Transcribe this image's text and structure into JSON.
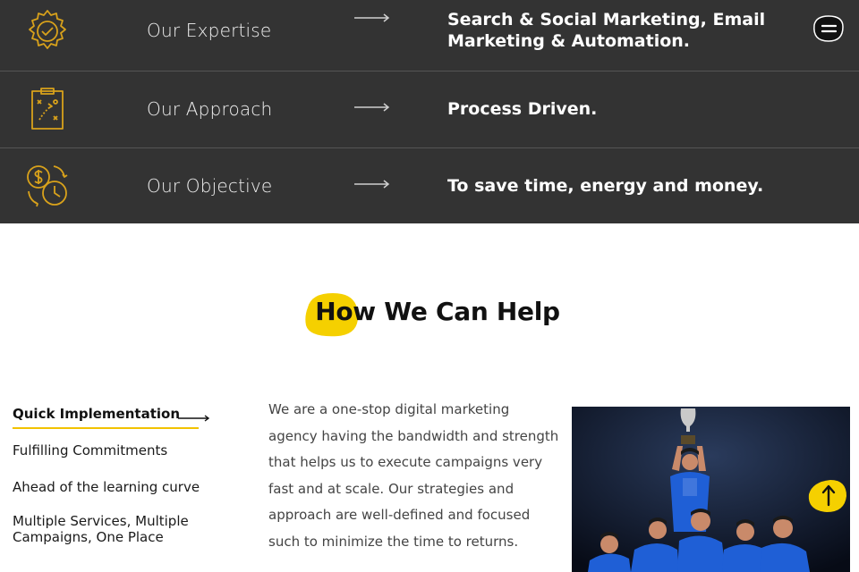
{
  "features": [
    {
      "icon": "gear-check-icon",
      "label": "Our Expertise",
      "value": "Search & Social Marketing, Email Marketing & Automation."
    },
    {
      "icon": "strategy-board-icon",
      "label": "Our Approach",
      "value": "Process Driven."
    },
    {
      "icon": "money-time-icon",
      "label": "Our Objective",
      "value": "To save time, energy and money."
    }
  ],
  "help": {
    "title": "How We Can Help",
    "tabs": [
      "Quick Implementation",
      "Fulfilling Commitments",
      "Ahead of the learning curve",
      "Multiple Services, Multiple Campaigns, One Place"
    ],
    "description": "We are a one-stop digital marketing agency having the bandwidth and strength that helps us to execute campaigns very fast and at scale. Our strategies and approach are well-defined and focused such to minimize the time to returns."
  },
  "colors": {
    "accent": "#f5d000",
    "band_bg": "#333333",
    "text_dark": "#111111"
  },
  "icons": {
    "menu": "hamburger-menu-icon",
    "scroll_top": "arrow-up-icon",
    "arrow": "long-arrow-right-icon"
  }
}
